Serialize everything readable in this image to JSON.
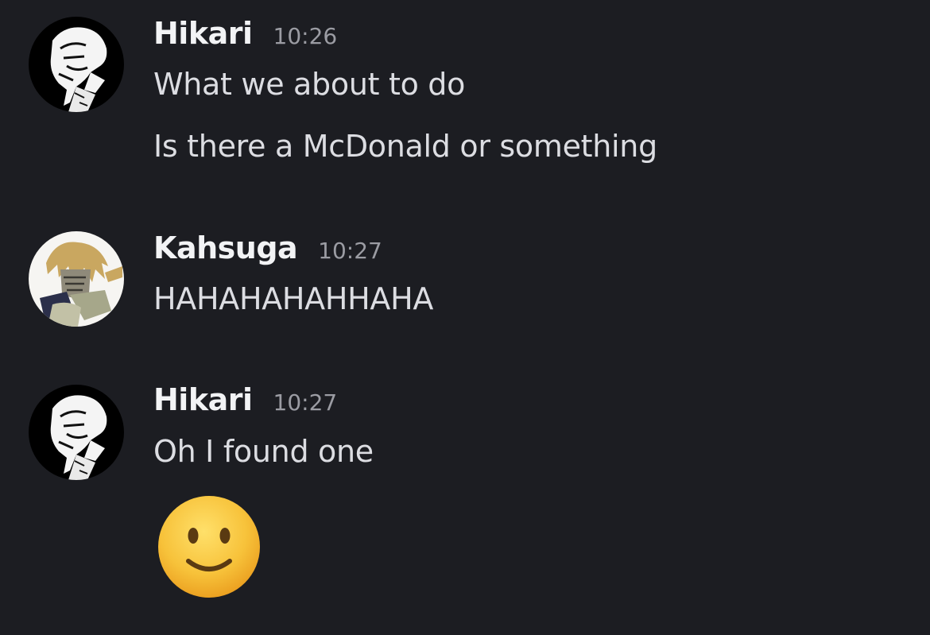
{
  "messages": [
    {
      "author": "Hikari",
      "time": "10:26",
      "lines": [
        "What we about to do",
        "Is there a McDonald or something"
      ]
    },
    {
      "author": "Kahsuga",
      "time": "10:27",
      "lines": [
        "HAHAHAHAHHAHA"
      ]
    },
    {
      "author": "Hikari",
      "time": "10:27",
      "lines": [
        "Oh I found one"
      ],
      "emoji": "slightly-smiling-face-icon"
    }
  ],
  "colors": {
    "background": "#1c1d22",
    "username": "#f2f3f5",
    "message_text": "#dcdde2",
    "timestamp": "#9b9ca3",
    "emoji_face": "#f7c23a"
  }
}
